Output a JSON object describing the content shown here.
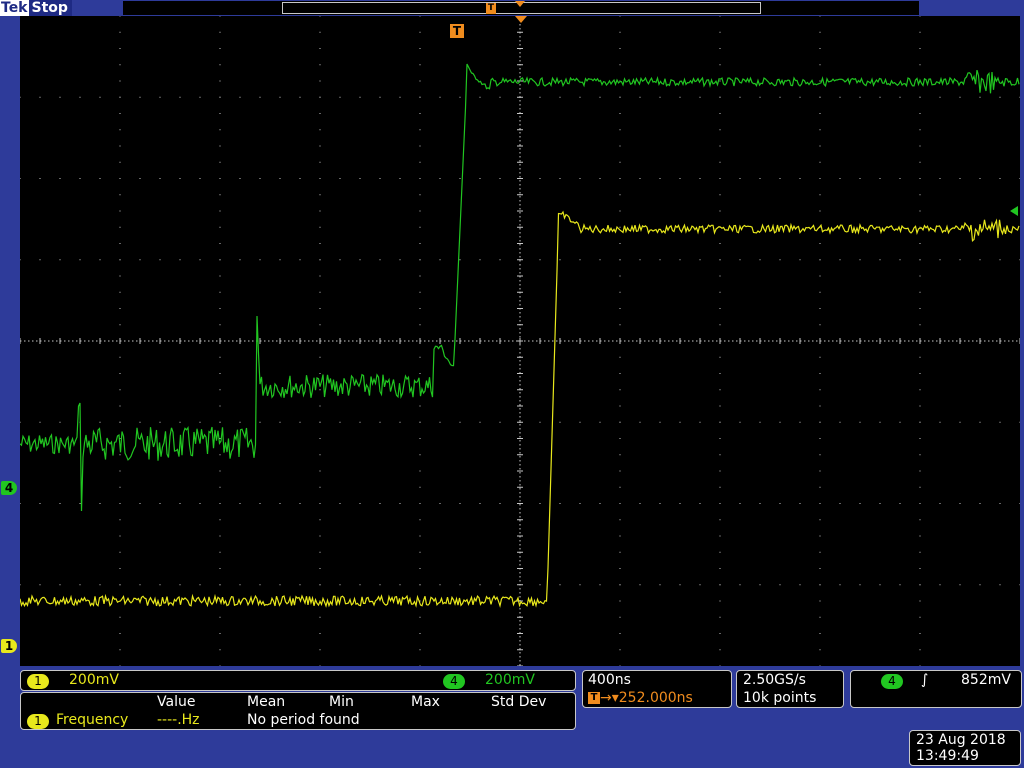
{
  "header": {
    "brand": "Tek",
    "acq_state": "Stop"
  },
  "markers": {
    "trigger_label": "T",
    "ch4_label": "4",
    "ch1_label": "1"
  },
  "channels": {
    "ch1": {
      "label": "1",
      "scale": "200mV",
      "color": "#e8e81c"
    },
    "ch4": {
      "label": "4",
      "scale": "200mV",
      "color": "#21c621"
    }
  },
  "measurement": {
    "headers": [
      "Value",
      "Mean",
      "Min",
      "Max",
      "Std Dev"
    ],
    "source": "1",
    "name": "Frequency",
    "value": "----.Hz",
    "status": "No period found"
  },
  "horizontal": {
    "scale": "400ns",
    "position": "252.000ns",
    "arrow": "→▾"
  },
  "acquisition": {
    "rate": "2.50GS/s",
    "length": "10k points"
  },
  "trigger": {
    "source": "4",
    "slope": "∫",
    "level": "852mV"
  },
  "datetime": {
    "date": "23 Aug 2018",
    "time": "13:49:49"
  },
  "colors": {
    "ch1": "#e8e81c",
    "ch4": "#21c621",
    "trigger": "#f08c1e",
    "frame": "#2e3b9a",
    "graticule": "#c8c8c8"
  }
}
